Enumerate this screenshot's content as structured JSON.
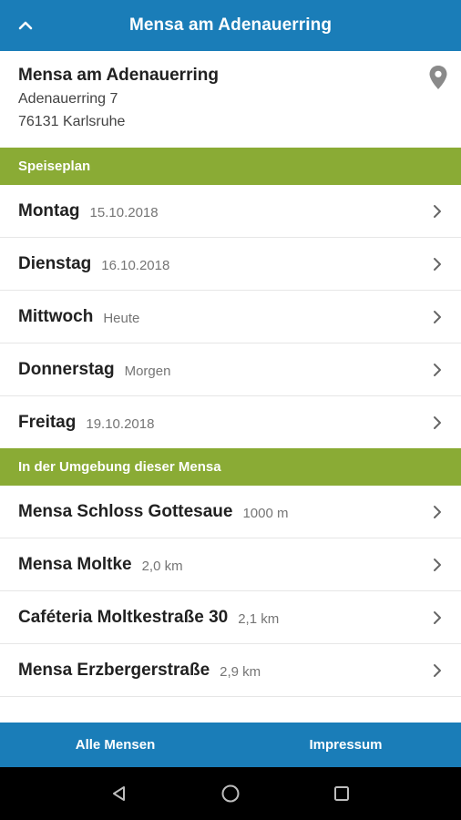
{
  "app_bar": {
    "title": "Mensa am Adenauerring"
  },
  "mensa": {
    "name": "Mensa am Adenauerring",
    "street": "Adenauerring 7",
    "city": "76131 Karlsruhe"
  },
  "speiseplan": {
    "header": "Speiseplan",
    "days": [
      {
        "day": "Montag",
        "date": "15.10.2018"
      },
      {
        "day": "Dienstag",
        "date": "16.10.2018"
      },
      {
        "day": "Mittwoch",
        "date": "Heute"
      },
      {
        "day": "Donnerstag",
        "date": "Morgen"
      },
      {
        "day": "Freitag",
        "date": "19.10.2018"
      }
    ]
  },
  "nearby": {
    "header": "In der Umgebung dieser Mensa",
    "items": [
      {
        "name": "Mensa Schloss Gottesaue",
        "distance": "1000 m"
      },
      {
        "name": "Mensa Moltke",
        "distance": "2,0 km"
      },
      {
        "name": "Caféteria Moltkestraße 30",
        "distance": "2,1 km"
      },
      {
        "name": "Mensa Erzbergerstraße",
        "distance": "2,9 km"
      }
    ]
  },
  "bottom_bar": {
    "all_label": "Alle Mensen",
    "impressum_label": "Impressum"
  },
  "colors": {
    "primary": "#1a7db8",
    "section": "#8aab35"
  }
}
